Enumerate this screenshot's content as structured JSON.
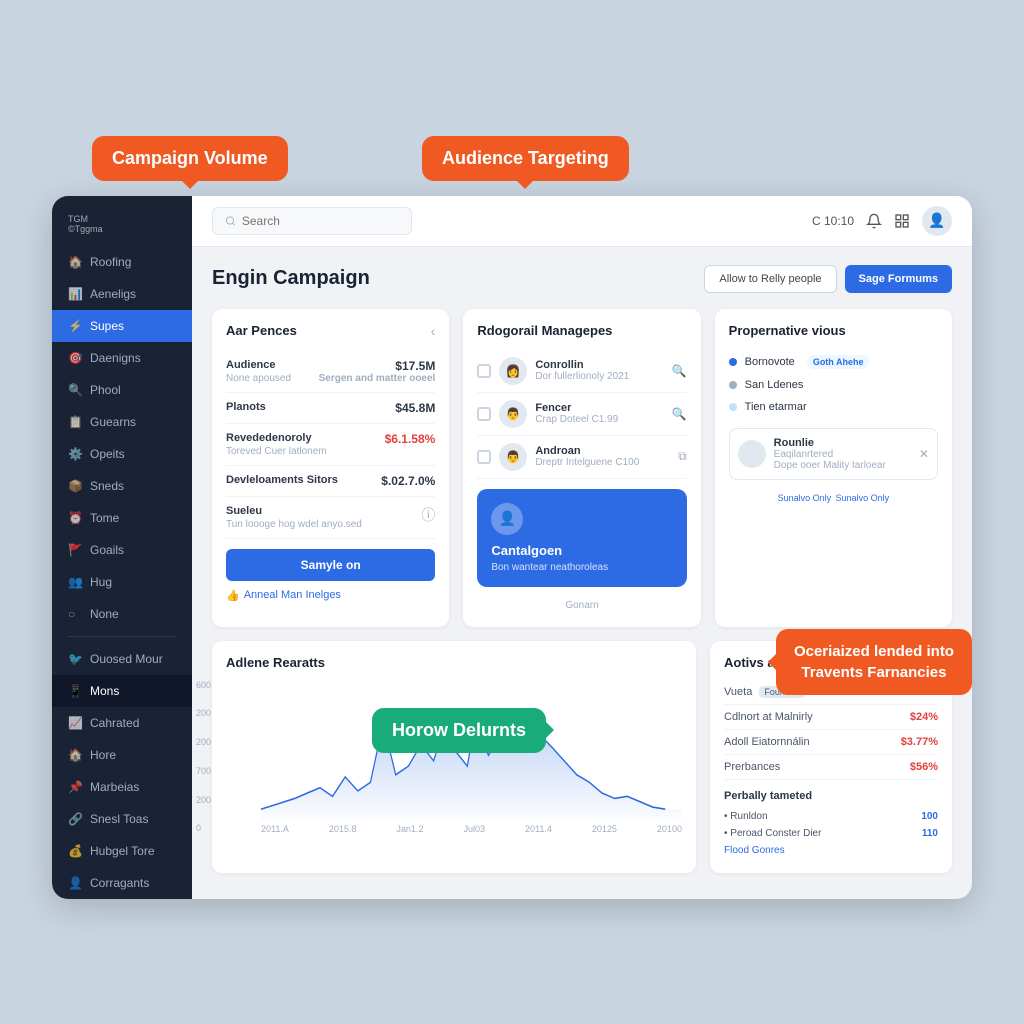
{
  "callouts": {
    "campaign_volume": "Campaign Volume",
    "audience_targeting": "Audience Targeting",
    "oceriaized": "Oceriaized lended into\nTravents Farnancies",
    "horow_delurnts": "Horow Delurnts"
  },
  "sidebar": {
    "logo": "TGM",
    "logo_sub": "©Tggma",
    "items": [
      {
        "label": "Roofing",
        "icon": "🏠"
      },
      {
        "label": "Aeneligs",
        "icon": "📊"
      },
      {
        "label": "Supes",
        "icon": "⚡",
        "active": true
      },
      {
        "label": "Daenigns",
        "icon": "🎯"
      },
      {
        "label": "Phool",
        "icon": "🔍"
      },
      {
        "label": "Guearns",
        "icon": "📋"
      },
      {
        "label": "Opeits",
        "icon": "⚙️"
      },
      {
        "label": "Sneds",
        "icon": "📦"
      },
      {
        "label": "Tome",
        "icon": "⏰"
      },
      {
        "label": "Goails",
        "icon": "🎯"
      },
      {
        "label": "Hug",
        "icon": "👥"
      },
      {
        "label": "None",
        "icon": "○"
      },
      {
        "label": "Ouosed Mour",
        "icon": "🐦",
        "section": true
      },
      {
        "label": "Mons",
        "icon": "📱",
        "active_dark": true
      },
      {
        "label": "Cahrated",
        "icon": "📈"
      },
      {
        "label": "Hore",
        "icon": "🏠"
      },
      {
        "label": "Marbeias",
        "icon": "📌"
      },
      {
        "label": "Snesl Toas",
        "icon": "🔗"
      },
      {
        "label": "Hubgel Tore",
        "icon": "💰"
      },
      {
        "label": "Corragants",
        "icon": "👤"
      }
    ]
  },
  "topbar": {
    "search_placeholder": "Search",
    "time": "C 10:10",
    "avatar_emoji": "👤"
  },
  "page": {
    "title": "Engin Campaign",
    "btn_allow": "Allow to Relly people",
    "btn_save": "Sage Formums"
  },
  "card_aar": {
    "title": "Aar Pences",
    "metrics": [
      {
        "label": "Audience",
        "sub": "None apoused",
        "value": "$17.5M",
        "value2": "Sergen and matter ooeel"
      },
      {
        "label": "Planots",
        "sub": "",
        "value": "$45.8M",
        "value2": ""
      },
      {
        "label": "Revededenoroly",
        "sub": "Toreved Cuer latlonem",
        "value": "$6.1.58%",
        "value_red": true
      },
      {
        "label": "Devleloaments Sitors",
        "sub": "",
        "value": "$.02.7.0%",
        "value2": ""
      },
      {
        "label": "Sueleu",
        "sub": "Tun loooge hog wdel anyo.sed",
        "value": "",
        "info": true
      }
    ],
    "btn_label": "Samyle on",
    "link_label": "Anneal Man Inelges"
  },
  "card_regional": {
    "title": "Rdogorail Managepes",
    "managers": [
      {
        "name": "Conrollin",
        "sub": "Dor fullerlionoly 2021",
        "emoji": "👩"
      },
      {
        "name": "Fencer",
        "sub": "Crap Doteel C1.99",
        "emoji": "👨"
      },
      {
        "name": "Androan",
        "sub": "Dreptr Intelguene C100",
        "emoji": "👨"
      }
    ],
    "footer": "Gonarn"
  },
  "card_prop": {
    "title": "Propernative vious",
    "items": [
      {
        "label": "Bornovote",
        "badge": "Goth Ahehe",
        "dot": "blue"
      },
      {
        "label": "San Ldenes",
        "dot": "gray"
      },
      {
        "label": "Tien etarmar",
        "dot": "light"
      }
    ],
    "user_name": "Eaqilanrtered",
    "user_sub": "Dope ooer Mality tarloear",
    "user_label": "Rounlie",
    "status": "Sunalvo Only"
  },
  "card_campaign": {
    "name": "Cantalgoen",
    "sub": "Bon wantear neathoroleas"
  },
  "chart": {
    "title": "Adlene Rearatts",
    "y_labels": [
      "600",
      "200",
      "200",
      "700",
      "200",
      "0"
    ],
    "x_labels": [
      "2011.A",
      "2015.8",
      "Jan1.2",
      "Jul03",
      "2011.4",
      "20125",
      "20100"
    ],
    "data": [
      10,
      15,
      20,
      12,
      25,
      18,
      30,
      22,
      15,
      80,
      35,
      20,
      45,
      30,
      55,
      40,
      25,
      60,
      35,
      50,
      70,
      40,
      55,
      45,
      30,
      20,
      15
    ]
  },
  "card_analytics": {
    "title": "Aotivs analatypic",
    "rows": [
      {
        "label": "Vueta",
        "tag": "Founded",
        "value": ""
      },
      {
        "label": "Cdlnort at Malnirly",
        "value": "$24%",
        "red": true
      },
      {
        "label": "Adoll Eiatornnálin",
        "value": "$3.77%",
        "red": true
      },
      {
        "label": "Prerbances",
        "value": "$56%",
        "red": true
      }
    ],
    "sub_title": "Perbally tameted",
    "tags": [
      {
        "label": "Runldon",
        "value": "100"
      },
      {
        "label": "Peroad Conster Dier",
        "value": "110"
      },
      {
        "label": "Flood Gonres",
        "value": ""
      }
    ]
  }
}
